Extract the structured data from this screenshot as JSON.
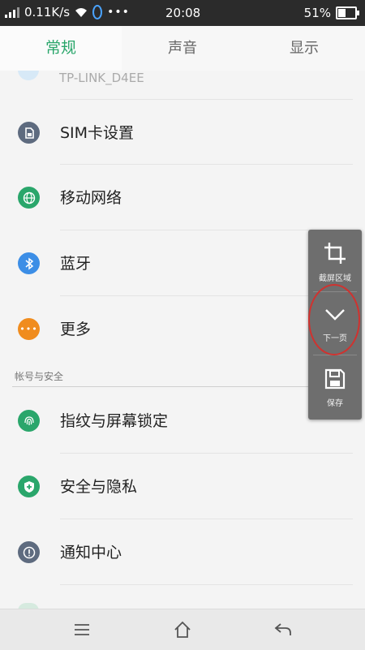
{
  "status_bar": {
    "speed": "0.11K/s",
    "time": "20:08",
    "battery": "51%",
    "battery_level": 0.51,
    "icons": [
      "signal-icon",
      "wifi-icon",
      "assistant-icon",
      "more-dots-icon",
      "battery-icon"
    ]
  },
  "tabs": [
    {
      "label": "常规",
      "active": true
    },
    {
      "label": "声音",
      "active": false
    },
    {
      "label": "显示",
      "active": false
    }
  ],
  "partial_item": {
    "label": "TP-LINK_D4EE"
  },
  "items": [
    {
      "label": "SIM卡设置",
      "icon": "sim-card-icon",
      "color": "#5e6b7f"
    },
    {
      "label": "移动网络",
      "icon": "globe-icon",
      "color": "#2aa66b"
    },
    {
      "label": "蓝牙",
      "icon": "bluetooth-icon",
      "color": "#3c8ee6"
    },
    {
      "label": "更多",
      "icon": "more-dots-icon",
      "color": "#f08c1e"
    }
  ],
  "section_header": "帐号与安全",
  "items2": [
    {
      "label": "指纹与屏幕锁定",
      "icon": "fingerprint-icon",
      "color": "#2aa66b"
    },
    {
      "label": "安全与隐私",
      "icon": "shield-icon",
      "color": "#2aa66b"
    },
    {
      "label": "通知中心",
      "icon": "alert-icon",
      "color": "#5e6b7f"
    }
  ],
  "float_panel": {
    "crop_label": "截屏区域",
    "next_label": "下一页",
    "save_label": "保存"
  },
  "colors": {
    "accent": "#2aa66b",
    "highlight": "#d0322f"
  }
}
